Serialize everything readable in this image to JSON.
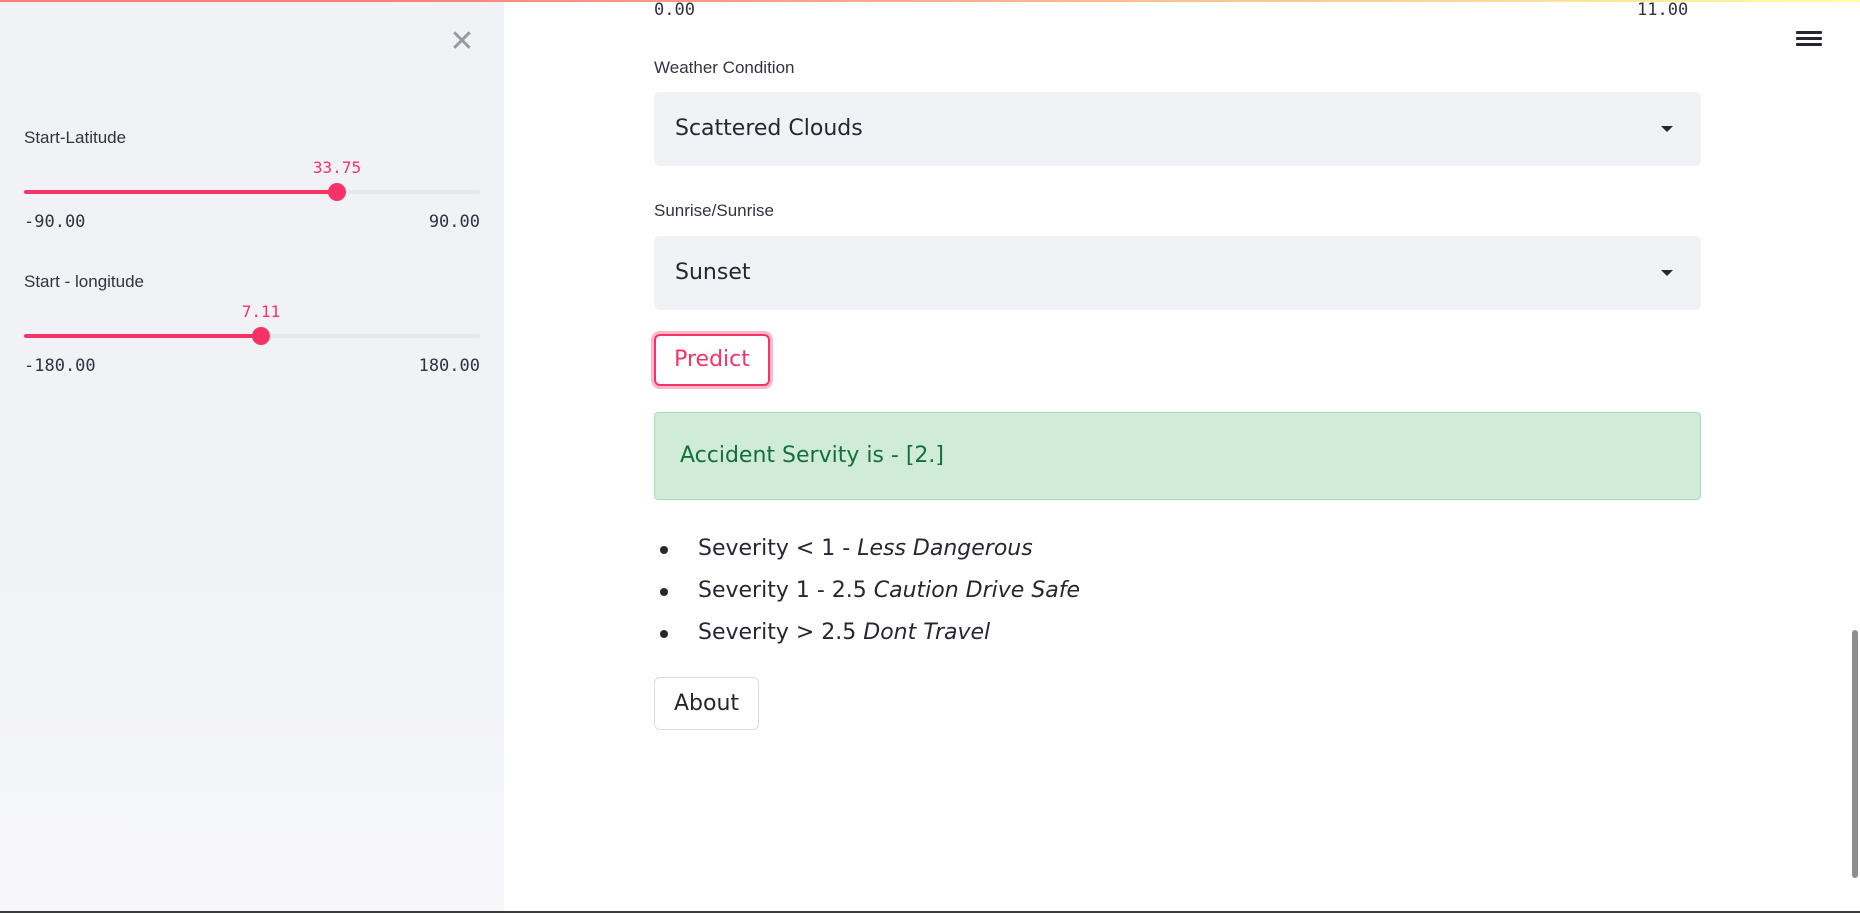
{
  "sidebar": {
    "close_icon": "close-icon",
    "sliders": [
      {
        "label": "Start-Latitude",
        "value": "33.75",
        "min": "-90.00",
        "max": "90.00",
        "fraction": 0.6875
      },
      {
        "label": "Start - longitude",
        "value": "7.11",
        "min": "-180.00",
        "max": "180.00",
        "fraction": 0.5198
      }
    ]
  },
  "main": {
    "prev_slider": {
      "min": "0.00",
      "max": "11.00"
    },
    "weather": {
      "label": "Weather Condition",
      "selected": "Scattered Clouds"
    },
    "sun": {
      "label": "Sunrise/Sunrise",
      "selected": "Sunset"
    },
    "predict_label": "Predict",
    "result": "Accident Servity is - [2.]",
    "legend": [
      {
        "text": "Severity < 1 - ",
        "emphasis": "Less Dangerous"
      },
      {
        "text": "Severity 1 - 2.5 ",
        "emphasis": "Caution Drive Safe"
      },
      {
        "text": "Severity > 2.5 ",
        "emphasis": "Dont Travel"
      }
    ],
    "about_label": "About"
  },
  "colors": {
    "accent": "#f63366",
    "success_bg": "#d0ecd8",
    "success_text": "#14703a",
    "sidebar_bg": "#f0f2f6"
  },
  "icons": {
    "menu": "hamburger-menu-icon",
    "caret": "caret-down-icon"
  }
}
